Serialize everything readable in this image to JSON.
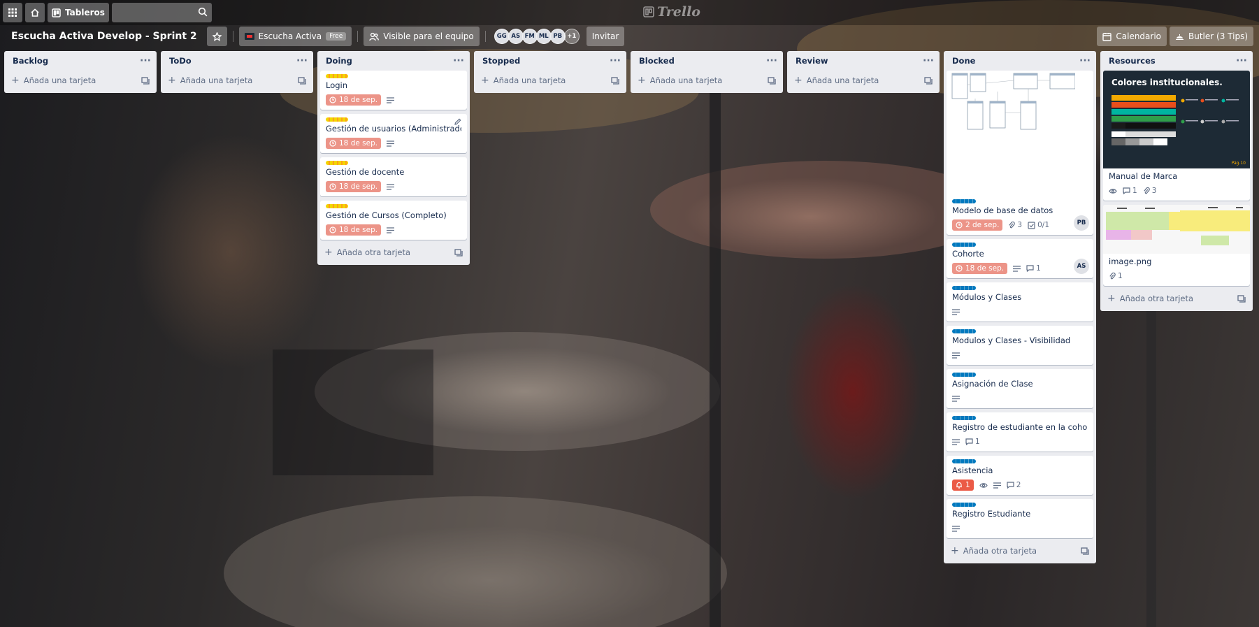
{
  "topnav": {
    "boards_label": "Tableros",
    "search_placeholder": "",
    "logo_text": "Trello"
  },
  "header": {
    "board_title": "Escucha Activa Develop - Sprint 2",
    "team_name": "Escucha Activa",
    "team_badge": "Free",
    "visibility": "Visible para el equipo",
    "members": [
      "GG",
      "AS",
      "FM",
      "ML",
      "PB"
    ],
    "members_more": "+1",
    "invite": "Invitar",
    "calendar": "Calendario",
    "butler": "Butler (3 Tips)"
  },
  "colors": {
    "list_bg": "#ebecf0",
    "due_soon": "#ec9488",
    "due_overdue": "#eb5a46",
    "label_yellow": "#f2d600",
    "label_blue": "#0079bf"
  },
  "lists": [
    {
      "title": "Backlog",
      "add_label": "Añada una tarjeta"
    },
    {
      "title": "ToDo",
      "add_label": "Añada una tarjeta"
    },
    {
      "title": "Doing",
      "add_label": "Añada otra tarjeta",
      "cards": [
        {
          "title": "Login",
          "due": "18 de sep."
        },
        {
          "title": "Gestión de usuarios (Administrador)",
          "due": "18 de sep."
        },
        {
          "title": "Gestión de docente",
          "due": "18 de sep."
        },
        {
          "title": "Gestión de Cursos (Completo)",
          "due": "18 de sep."
        }
      ]
    },
    {
      "title": "Stopped",
      "add_label": "Añada una tarjeta"
    },
    {
      "title": "Blocked",
      "add_label": "Añada una tarjeta"
    },
    {
      "title": "Review",
      "add_label": "Añada una tarjeta"
    },
    {
      "title": "Done",
      "add_label": "Añada otra tarjeta",
      "cards": [
        {
          "title": "Modelo de base de datos",
          "due": "2 de sep.",
          "attachments": "3",
          "checklist": "0/1",
          "member": "PB"
        },
        {
          "title": "Cohorte",
          "due": "18 de sep.",
          "comments": "1",
          "member": "AS"
        },
        {
          "title": "Módulos y Clases"
        },
        {
          "title": "Modulos y Clases - Visibilidad"
        },
        {
          "title": "Asignación de Clase"
        },
        {
          "title": "Registro de estudiante en la cohorte",
          "comments": "1"
        },
        {
          "title": "Asistencia",
          "notifications": "1",
          "comments": "2"
        },
        {
          "title": "Registro Estudiante"
        }
      ]
    },
    {
      "title": "Resources",
      "add_label": "Añada otra tarjeta",
      "cards": [
        {
          "title": "Manual de Marca",
          "comments": "1",
          "attachments": "3",
          "cover_title": "Colores institucionales.",
          "cover_page": "Pág.10"
        },
        {
          "title": "image.png",
          "attachments": "1"
        }
      ]
    }
  ]
}
